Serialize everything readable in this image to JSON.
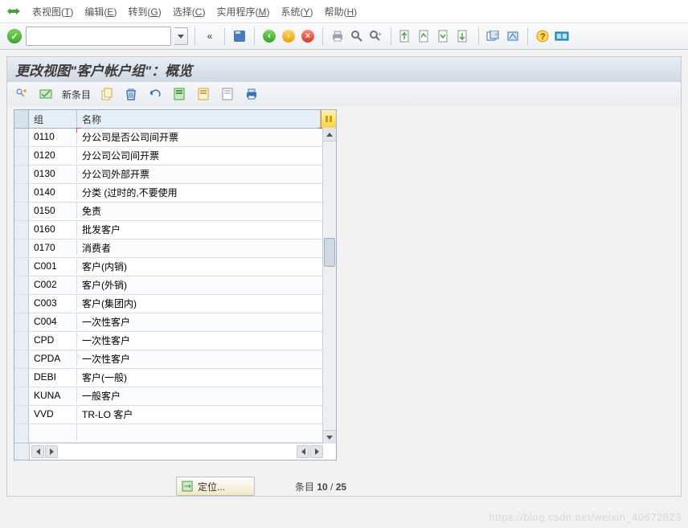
{
  "menubar": {
    "items": [
      {
        "label": "表视图",
        "accel": "T"
      },
      {
        "label": "编辑",
        "accel": "E"
      },
      {
        "label": "转到",
        "accel": "G"
      },
      {
        "label": "选择",
        "accel": "C"
      },
      {
        "label": "实用程序",
        "accel": "M"
      },
      {
        "label": "系统",
        "accel": "Y"
      },
      {
        "label": "帮助",
        "accel": "H"
      }
    ]
  },
  "apptoolbar": {
    "back_glyph": "«"
  },
  "page_title": "更改视图\"客户帐户组\"：概览",
  "viewtoolbar": {
    "new_entries_label": "新条目"
  },
  "table": {
    "headers": {
      "col1": "组",
      "col2": "名称"
    },
    "rows": [
      {
        "code": "0110",
        "name": "分公司是否公司间开票"
      },
      {
        "code": "0120",
        "name": "分公司公司间开票"
      },
      {
        "code": "0130",
        "name": "分公司外部开票"
      },
      {
        "code": "0140",
        "name": "分类 (过时的,不要使用"
      },
      {
        "code": "0150",
        "name": "免责"
      },
      {
        "code": "0160",
        "name": "批发客户"
      },
      {
        "code": "0170",
        "name": "消费者"
      },
      {
        "code": "C001",
        "name": "客户(内销)"
      },
      {
        "code": "C002",
        "name": "客户(外销)"
      },
      {
        "code": "C003",
        "name": "客户(集团内)"
      },
      {
        "code": "C004",
        "name": "一次性客户"
      },
      {
        "code": "CPD",
        "name": "一次性客户"
      },
      {
        "code": "CPDA",
        "name": "一次性客户"
      },
      {
        "code": "DEBI",
        "name": "客户(一般)"
      },
      {
        "code": "KUNA",
        "name": "一般客户"
      },
      {
        "code": "VVD",
        "name": "TR-LO 客户"
      },
      {
        "code": "",
        "name": ""
      }
    ]
  },
  "position_button_label": "定位...",
  "entry_counter": {
    "prefix": "条目 ",
    "current": "10",
    "sep": " / ",
    "total": "25"
  },
  "watermark": "https://blog.csdn.net/weixin_40672823"
}
